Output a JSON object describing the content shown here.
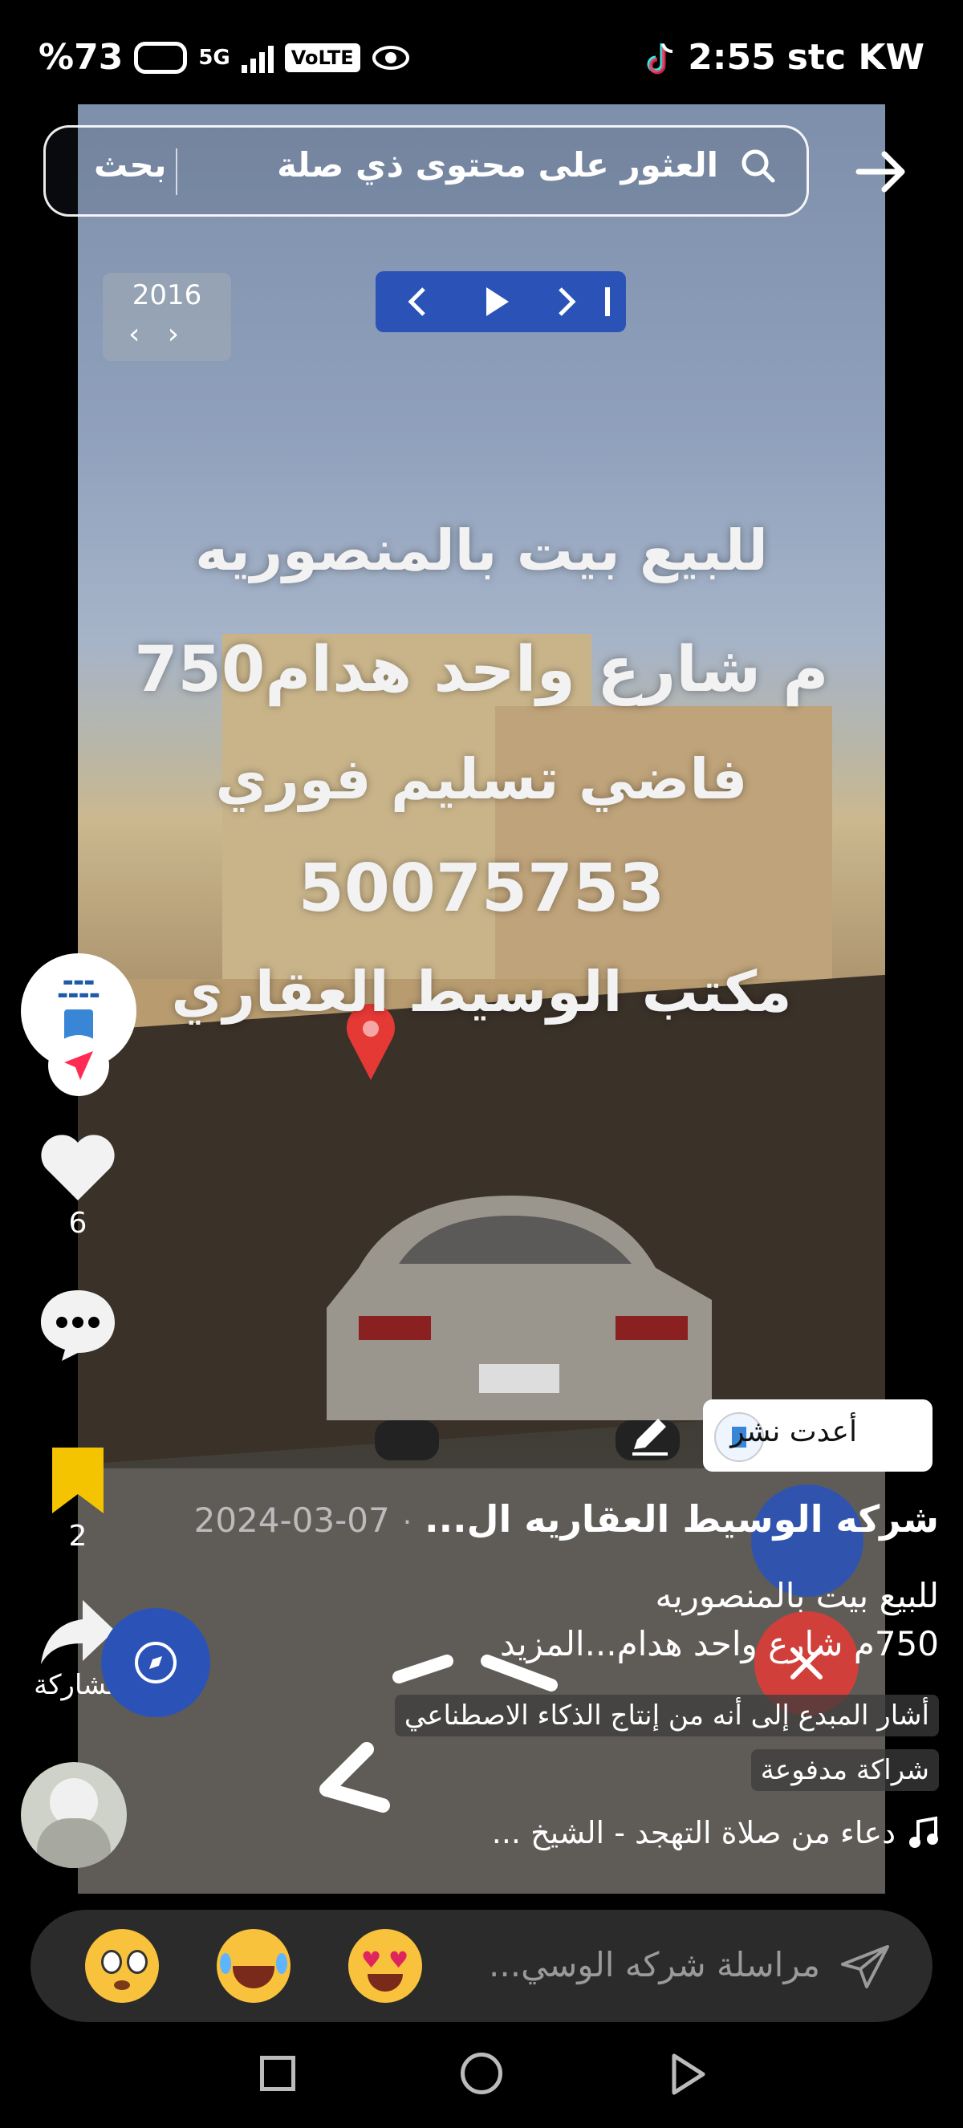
{
  "status_bar": {
    "battery": "%73",
    "network": "5G",
    "volte": "VoLTE",
    "time": "2:55",
    "carrier": "stc KW"
  },
  "search": {
    "placeholder": "العثور على محتوى ذي صلة",
    "button_label": "بحث"
  },
  "video": {
    "year": "2016",
    "overlay_lines": [
      "للبيع بيت بالمنصوريه",
      "750م شارع واحد هدام",
      "فاضي تسليم فوري",
      "50075753",
      "مكتب الوسيط العقاري"
    ]
  },
  "actions": {
    "likes": "6",
    "saves": "2",
    "share_label": "مشاركة"
  },
  "repost": {
    "label": "أعدت نشر"
  },
  "post": {
    "author": "شركه الوسيط العقاريه ال...",
    "date": "2024-03-07",
    "separator": "·",
    "caption_line1": "للبيع بيت بالمنصوريه",
    "caption_line2": "750م شارع واحد هدام...المزيد",
    "ai_label": "أشار المبدع إلى أنه من إنتاج الذكاء الاصطناعي",
    "paid_label": "شراكة مدفوعة",
    "sound": "دعاء من صلاة التهجد - الشيخ ..."
  },
  "message": {
    "placeholder": "مراسلة شركه الوسي..."
  },
  "colors": {
    "accent_blue": "#2b53b7",
    "bookmark_yellow": "#f5c400",
    "pin_red": "#e53935"
  }
}
